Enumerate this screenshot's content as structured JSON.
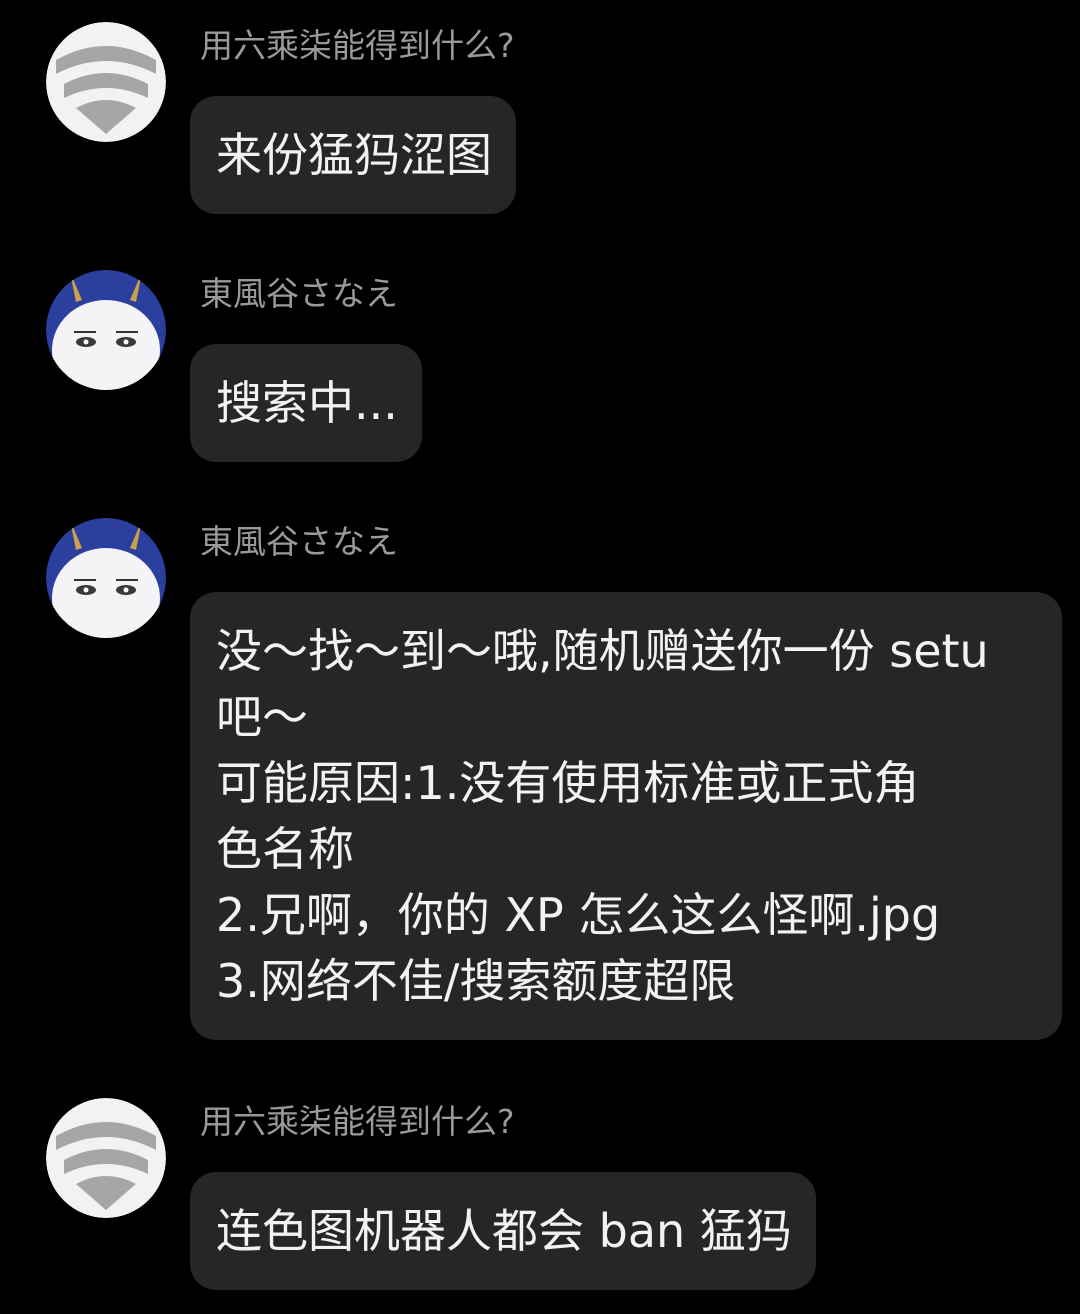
{
  "messages": [
    {
      "sender": "用六乘柒能得到什么?",
      "avatar_icon": "wifi-avatar-icon",
      "lines": [
        "来份猛犸涩图"
      ]
    },
    {
      "sender": "東風谷さなえ",
      "avatar_icon": "character-avatar-icon",
      "lines": [
        "搜索中..."
      ]
    },
    {
      "sender": "東風谷さなえ",
      "avatar_icon": "character-avatar-icon",
      "lines": [
        "没～找～到～哦,随机赠送你一份 setu",
        "吧～",
        "可能原因:1.没有使用标准或正式角",
        "色名称",
        "2.兄啊，你的 XP 怎么这么怪啊.jpg",
        "3.网络不佳/搜索额度超限"
      ]
    },
    {
      "sender": "用六乘柒能得到什么?",
      "avatar_icon": "wifi-avatar-icon",
      "lines": [
        "连色图机器人都会 ban 猛犸"
      ]
    }
  ],
  "colors": {
    "background": "#000000",
    "bubble": "#262626",
    "sender_text": "#9a9a9a",
    "message_text": "#f2f2f2",
    "wifi_avatar_bg": "#f2f2f2",
    "wifi_avatar_fg": "#a6a6a6",
    "character_hair": "#2b3f9e"
  }
}
